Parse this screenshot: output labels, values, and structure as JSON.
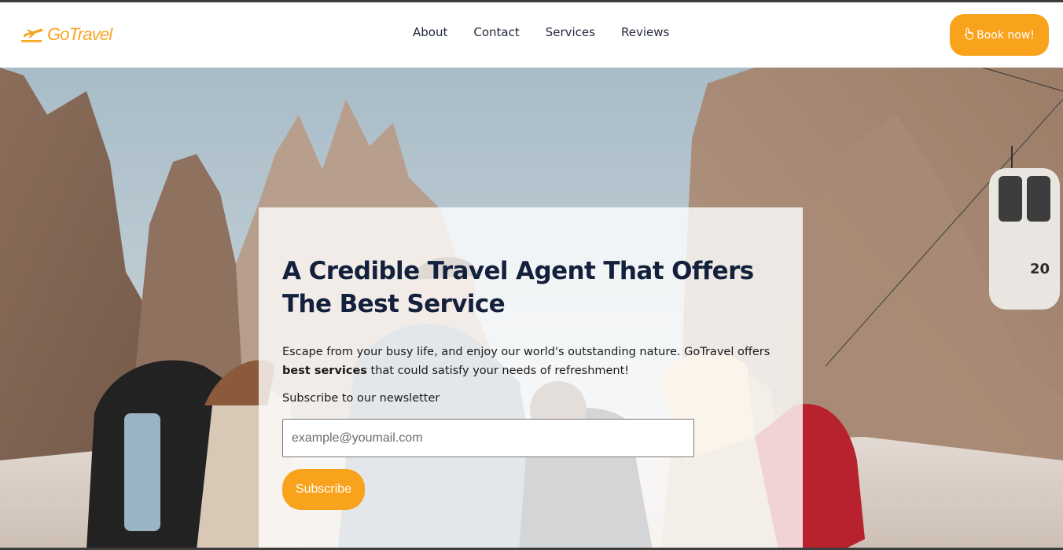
{
  "header": {
    "logo_text": "GoTravel",
    "nav": {
      "about": "About",
      "contact": "Contact",
      "services": "Services",
      "reviews": "Reviews"
    },
    "book_label": "Book now!"
  },
  "hero": {
    "title": "A Credible Travel Agent That Offers The Best Service",
    "lead_before": "Escape from your busy life, and enjoy our world's outstanding nature. GoTravel offers ",
    "lead_bold": "best services",
    "lead_after": " that could satisfy your needs of refreshment!",
    "subscribe_label": "Subscribe to our newsletter",
    "email_placeholder": "example@youmail.com",
    "subscribe_button": "Subscribe",
    "gondola_number": "20"
  },
  "icons": {
    "logo": "airplane-icon",
    "book": "pointing-hand-icon"
  },
  "colors": {
    "accent": "#f9a21b",
    "heading": "#14213d",
    "nav_text": "#1f2937"
  }
}
